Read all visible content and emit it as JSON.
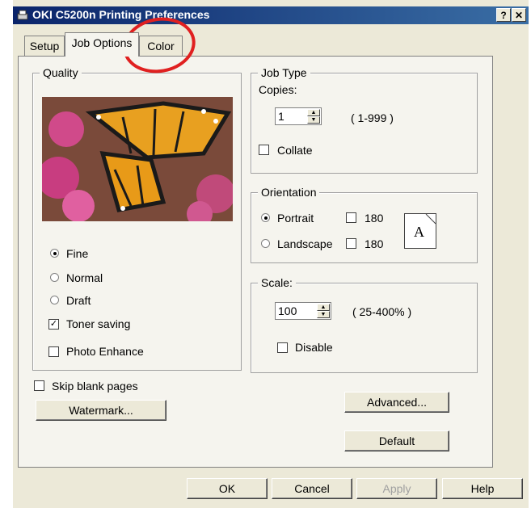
{
  "window": {
    "title": "OKI C5200n Printing Preferences",
    "help_btn": "?",
    "close_btn": "✕"
  },
  "tabs": [
    {
      "label": "Setup"
    },
    {
      "label": "Job Options"
    },
    {
      "label": "Color"
    }
  ],
  "quality": {
    "legend": "Quality",
    "fine": "Fine",
    "normal": "Normal",
    "draft": "Draft",
    "toner_saving": "Toner saving",
    "photo_enhance": "Photo Enhance",
    "selected": "Fine",
    "toner_saving_checked": true,
    "photo_enhance_checked": false
  },
  "job_type": {
    "legend": "Job Type",
    "copies_label": "Copies:",
    "copies_value": "1",
    "copies_range": "( 1-999 )",
    "collate": "Collate",
    "collate_checked": false
  },
  "orientation": {
    "legend": "Orientation",
    "portrait": "Portrait",
    "landscape": "Landscape",
    "rotate_label": "180",
    "selected": "Portrait",
    "page_icon_letter": "A"
  },
  "scale": {
    "legend": "Scale:",
    "value": "100",
    "range": "( 25-400% )",
    "disable": "Disable"
  },
  "skip_blank_pages": "Skip blank pages",
  "buttons": {
    "watermark": "Watermark...",
    "advanced": "Advanced...",
    "default": "Default",
    "ok": "OK",
    "cancel": "Cancel",
    "apply": "Apply",
    "help": "Help"
  },
  "icons": {
    "spin_up": "▲",
    "spin_down": "▼",
    "checkmark": "✓"
  },
  "colors": {
    "annotation_circle": "#e02020",
    "titlebar": "#0a246a"
  }
}
